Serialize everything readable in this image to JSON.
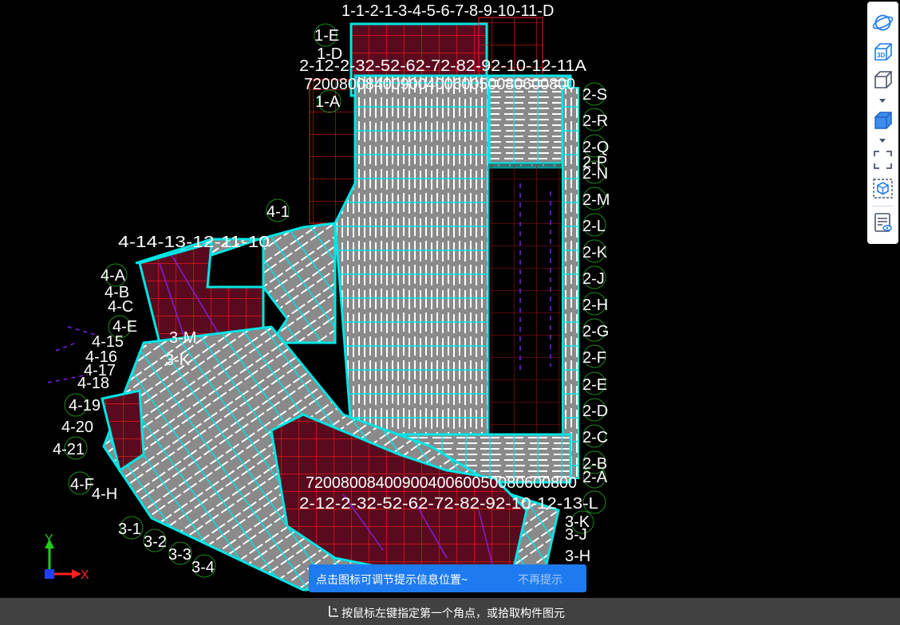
{
  "viewport": {
    "axis_labels": {
      "top": [
        "1-1-2-1-3-4-5-6-7-8-9-10-11-D",
        "1-E",
        "1-D",
        "1-A"
      ],
      "north_dims": [
        "2-12-2-32-52-62-72-82-92-10-12-11A",
        "7200800840090040060050080600800"
      ],
      "east": [
        "2-S",
        "2-R",
        "2-Q",
        "2-P",
        "2-N",
        "2-M",
        "2-L",
        "2-K",
        "2-J",
        "2-H",
        "2-G",
        "2-F",
        "2-E",
        "2-D",
        "2-C",
        "2-B",
        "2-A"
      ],
      "south_dims": [
        "7200800840090040060050080600800",
        "2-12-2-32-52-62-72-82-92-10-12-13-L"
      ],
      "southeast": [
        "3-K",
        "3-J",
        "3-H"
      ],
      "west": [
        "4-1",
        "4-14-13-12-11-10",
        "4-A",
        "4-B",
        "4-C",
        "4-E",
        "4-15",
        "4-16",
        "4-17",
        "4-18",
        "4-19",
        "4-20",
        "4-21",
        "4-F",
        "4-H",
        "3-M",
        "3-K"
      ],
      "southwest": [
        "3-1",
        "3-2",
        "3-3",
        "3-4"
      ]
    },
    "axis_indicator": {
      "y_label": "Y",
      "x_label": "X"
    },
    "colors": {
      "background": "#000000",
      "wall": "#00e5e5",
      "rebar": "#ffffff",
      "beam": "#ff1a1a",
      "slab_fill": "#8a8a8a",
      "room": "#7a1030",
      "aux": "#7d20e0",
      "bubble": "#1f8a1f"
    }
  },
  "toolbar": {
    "items": [
      {
        "icon": "orbit-view-icon",
        "label": ""
      },
      {
        "icon": "3d-view-icon",
        "label": "3D"
      },
      {
        "icon": "wireframe-cube-icon",
        "label": ""
      },
      {
        "icon": "shaded-cube-icon",
        "label": ""
      },
      {
        "icon": "full-extent-icon",
        "label": ""
      },
      {
        "icon": "component-select-icon",
        "label": ""
      },
      {
        "icon": "view-properties-icon",
        "label": ""
      }
    ]
  },
  "tip": {
    "text": "点击图标可调节提示信息位置~",
    "dismiss": "不再提示"
  },
  "status_bar": {
    "text": "按鼠标左键指定第一个角点，或拾取构件图元"
  }
}
